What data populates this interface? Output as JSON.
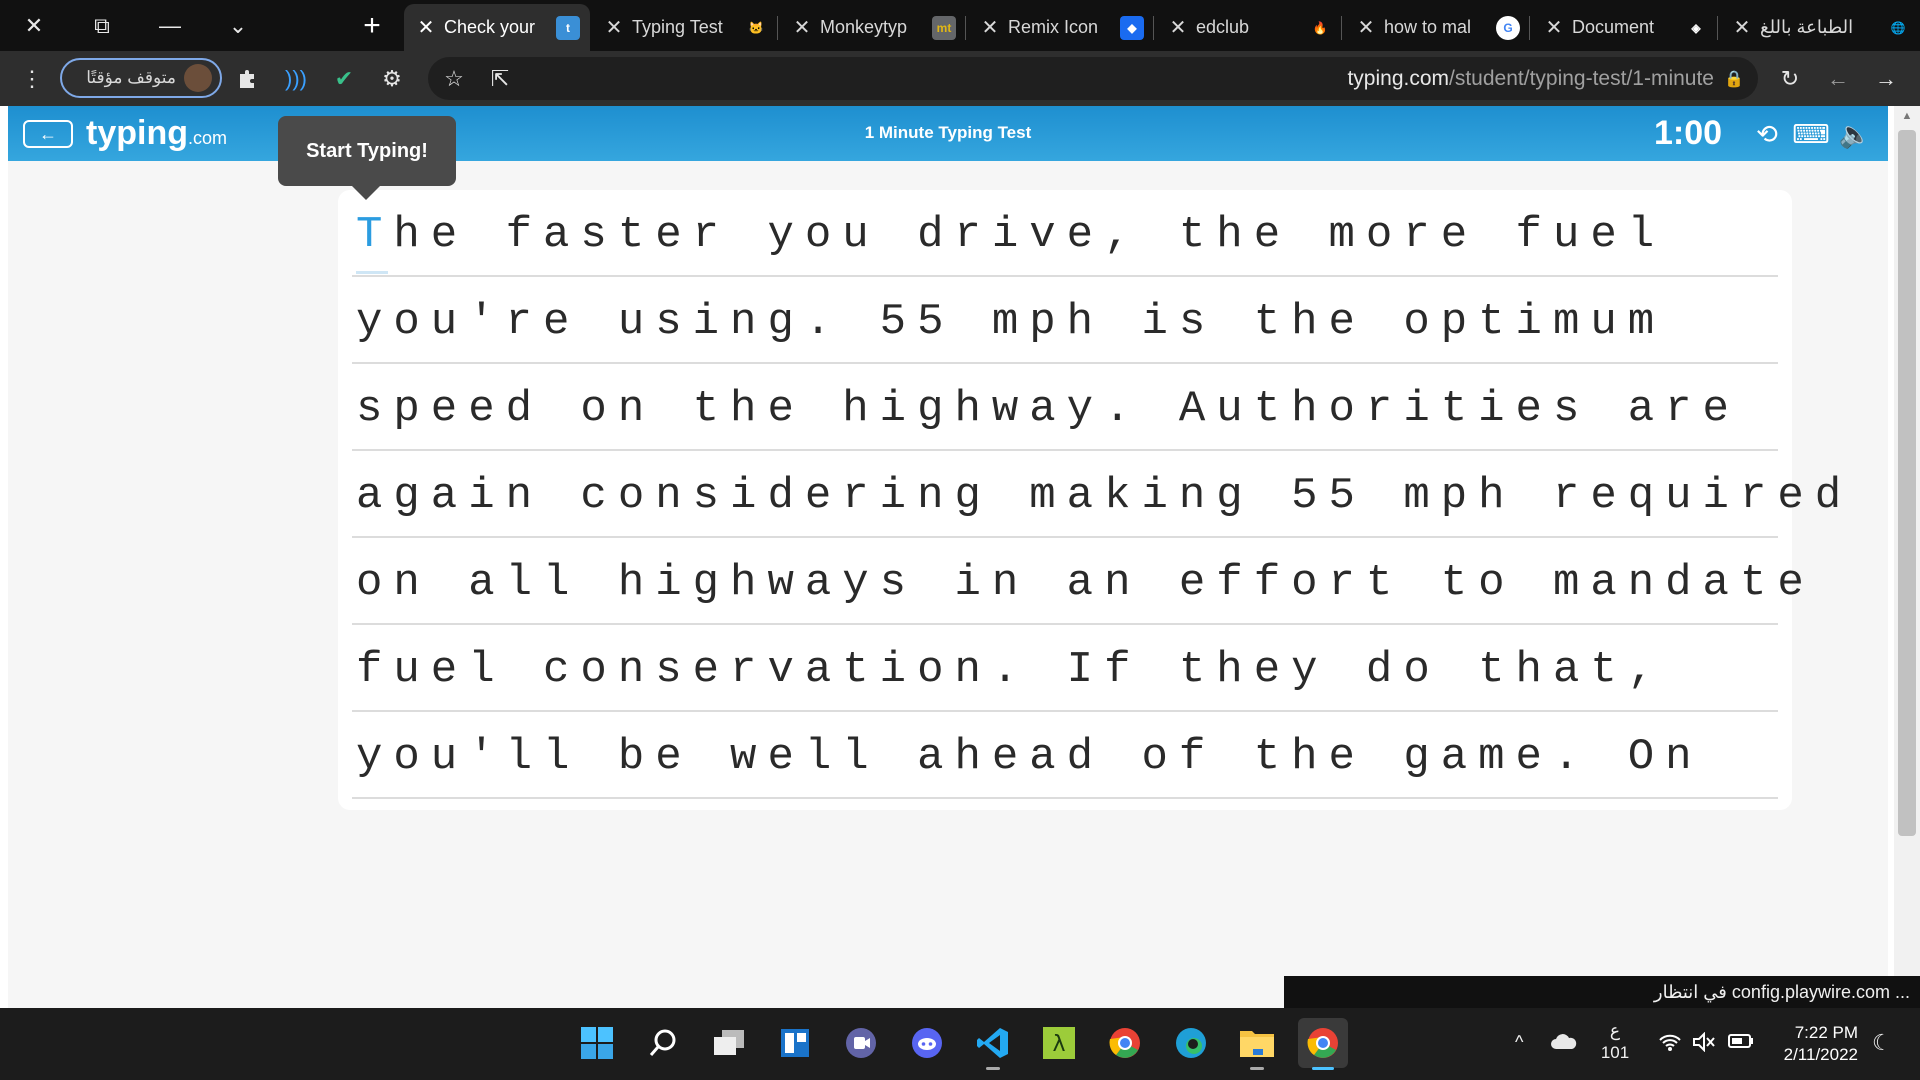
{
  "window_controls": {
    "close": "✕",
    "restore": "⧉",
    "minimize": "—",
    "tab_search": "⌄"
  },
  "tabs": [
    {
      "title": "Check your",
      "favicon": "t",
      "color": "#3a8fd6",
      "active": true
    },
    {
      "title": "Typing Test",
      "favicon": "🐱",
      "color": "#2e2e2e",
      "active": false
    },
    {
      "title": "Monkeytyp",
      "favicon": "mt",
      "color": "#e2b714",
      "active": false
    },
    {
      "title": "Remix Icon",
      "favicon": "◆",
      "color": "#1a6bf0",
      "active": false
    },
    {
      "title": "edclub",
      "favicon": "🔥",
      "color": "#111111",
      "active": false
    },
    {
      "title": "how to mal",
      "favicon": "G",
      "color": "#ffffff",
      "active": false
    },
    {
      "title": "Document",
      "favicon": "◈",
      "color": "#111111",
      "active": false
    },
    {
      "title": "الطباعة باللغ",
      "favicon": "🌐",
      "color": "#111111",
      "active": false
    }
  ],
  "tab_close_glyph": "✕",
  "new_tab_glyph": "+",
  "toolbar": {
    "menu_glyph": "⋮",
    "profile_label": "متوقف مؤقتًا",
    "extension_icons": [
      "puzzle-icon",
      "wave-icon",
      "check-icon",
      "gear-icon"
    ],
    "url_host": "typing.com",
    "url_path": "/student/typing-test/1-minute",
    "lock_glyph": "🔒",
    "reload_glyph": "↻",
    "back_glyph": "←",
    "forward_glyph": "→",
    "star_glyph": "☆",
    "share_glyph": "⇱"
  },
  "header": {
    "back_glyph": "←",
    "logo_main": "typing",
    "logo_suffix": ".com",
    "title": "1 Minute Typing Test",
    "timer": "1:00",
    "history_glyph": "⟲",
    "keyboard_glyph": "⌨",
    "sound_glyph": "🔈"
  },
  "tooltip": "Start Typing!",
  "typing": {
    "first_char": "T",
    "lines": [
      "he faster you drive, the more fuel",
      "you're using. 55 mph is the optimum",
      "speed on the highway. Authorities are",
      "again considering making 55 mph required",
      "on all highways in an effort to mandate",
      "fuel conservation. If they do that,",
      "you'll be well ahead of the game. On"
    ]
  },
  "status_bubble": "في انتظار config.playwire.com ...",
  "taskbar": {
    "apps": [
      "windows-start",
      "search",
      "task-view",
      "widgets",
      "teams-chat",
      "discord",
      "vscode",
      "lambda-app",
      "chrome",
      "edge",
      "file-explorer",
      "chrome-active"
    ],
    "tray": {
      "chevron": "^",
      "lang_top": "ع",
      "lang_bottom": "101",
      "time": "7:22 PM",
      "date": "2/11/2022"
    }
  },
  "colors": {
    "header_blue": "#2a9ad8",
    "accent_cursor": "#2b9ce0"
  }
}
